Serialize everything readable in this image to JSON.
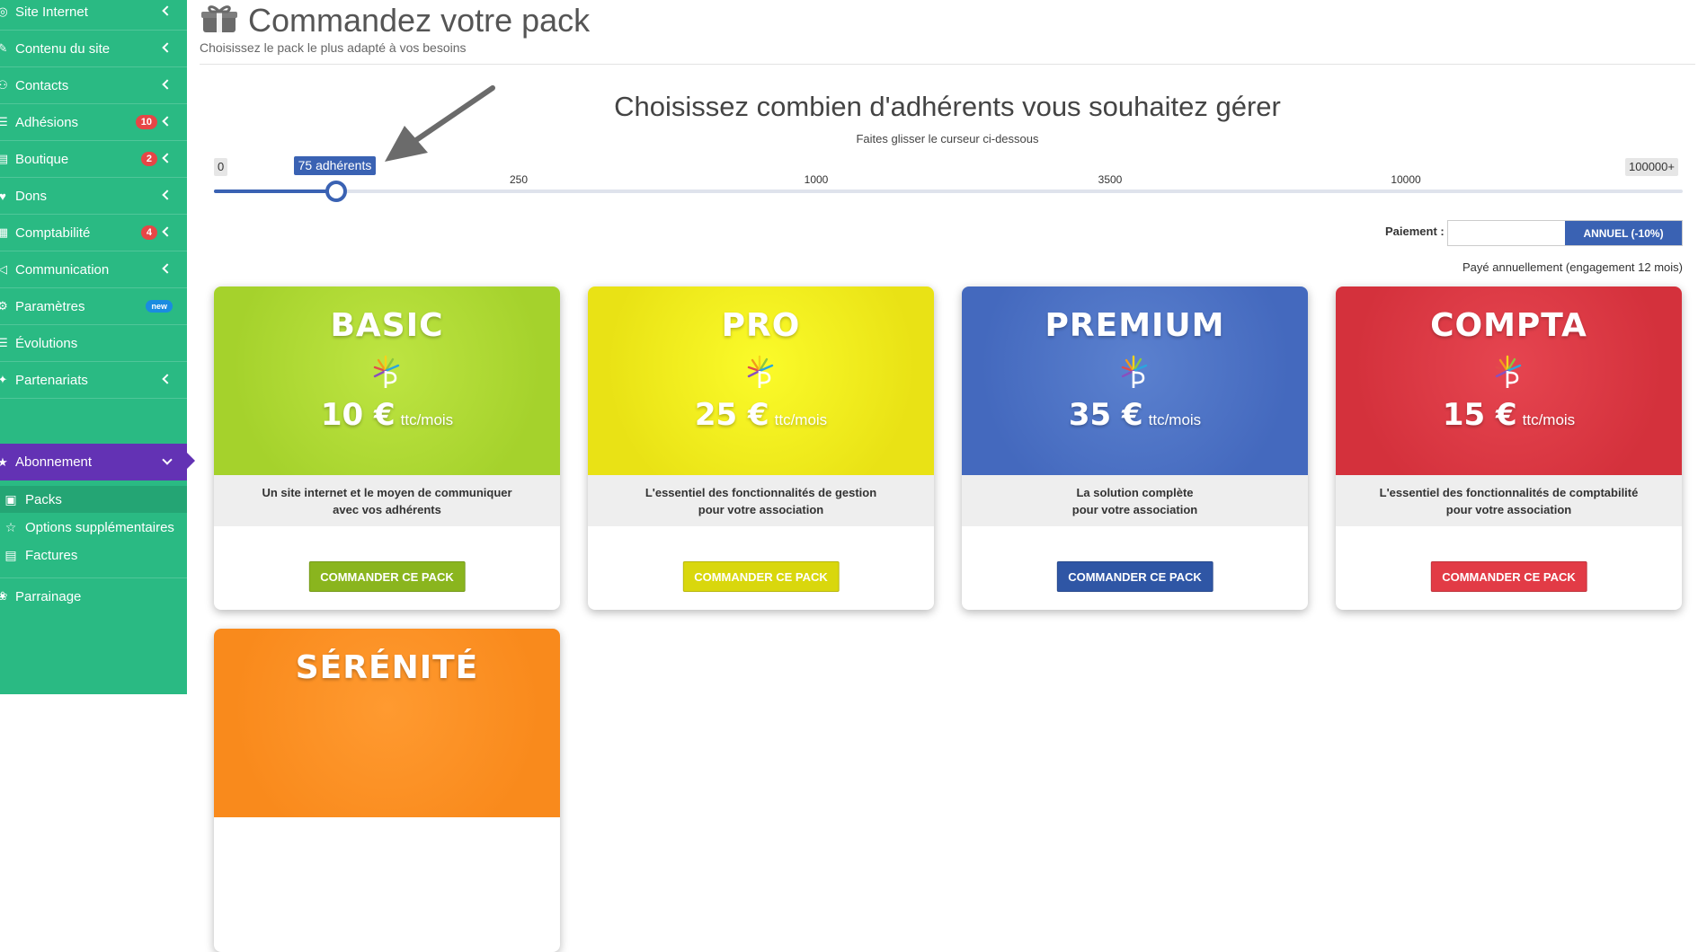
{
  "sidebar": {
    "items": [
      {
        "label": "Site Internet",
        "icon": "globe-icon",
        "badge": ""
      },
      {
        "label": "Contenu du site",
        "icon": "edit-icon",
        "badge": ""
      },
      {
        "label": "Contacts",
        "icon": "users-icon",
        "badge": ""
      },
      {
        "label": "Adhésions",
        "icon": "list-icon",
        "badge": "10"
      },
      {
        "label": "Boutique",
        "icon": "shop-icon",
        "badge": "2"
      },
      {
        "label": "Dons",
        "icon": "donate-icon",
        "badge": ""
      },
      {
        "label": "Comptabilité",
        "icon": "calculator-icon",
        "badge": "4"
      },
      {
        "label": "Communication",
        "icon": "megaphone-icon",
        "badge": ""
      },
      {
        "label": "Paramètres",
        "icon": "gear-icon",
        "badge": "new"
      },
      {
        "label": "Évolutions",
        "icon": "list-icon",
        "badge": ""
      },
      {
        "label": "Partenariats",
        "icon": "handshake-icon",
        "badge": ""
      }
    ],
    "active": {
      "label": "Abonnement",
      "icon": "star-icon"
    },
    "subitems": [
      {
        "label": "Packs",
        "icon": "box-icon"
      },
      {
        "label": "Options supplémentaires",
        "icon": "star-outline-icon"
      },
      {
        "label": "Factures",
        "icon": "invoice-icon"
      }
    ],
    "parrainage": {
      "label": "Parrainage",
      "icon": "gift-hand-icon"
    }
  },
  "header": {
    "title": "Commandez votre pack",
    "subtitle": "Choisissez le pack le plus adapté à vos besoins"
  },
  "slider": {
    "title": "Choisissez combien d'adhérents vous souhaitez gérer",
    "subtitle": "Faites glisser le curseur ci-dessous",
    "min_label": "0",
    "max_label": "100000+",
    "ticks": [
      "250",
      "1000",
      "3500",
      "10000"
    ],
    "value_label": "75 adhérents",
    "value_fraction": 0.083
  },
  "payment": {
    "label": "Paiement :",
    "option_monthly": "",
    "option_annual": "ANNUEL (-10%)",
    "note": "Payé annuellement (engagement 12 mois)"
  },
  "cards": [
    {
      "name": "BASIC",
      "price": "10 €",
      "period": "ttc/mois",
      "desc1": "Un site internet et le moyen de communiquer",
      "desc2": "avec vos adhérents",
      "button": "COMMANDER CE PACK",
      "color_light": "#bee542",
      "color_dark": "#a5d22c",
      "btn_color": "#8ab51e"
    },
    {
      "name": "PRO",
      "price": "25 €",
      "period": "ttc/mois",
      "desc1": "L'essentiel des fonctionnalités de gestion",
      "desc2": "pour votre association",
      "button": "COMMANDER CE PACK",
      "color_light": "#fbfb2a",
      "color_dark": "#e9e215",
      "btn_color": "#d9d70d"
    },
    {
      "name": "PREMIUM",
      "price": "35 €",
      "period": "ttc/mois",
      "desc1": "La solution complète",
      "desc2": "pour votre association",
      "button": "COMMANDER CE PACK",
      "color_light": "#5b81cf",
      "color_dark": "#4469be",
      "btn_color": "#2f56a5"
    },
    {
      "name": "COMPTA",
      "price": "15 €",
      "period": "ttc/mois",
      "desc1": "L'essentiel des fonctionnalités de comptabilité",
      "desc2": "pour votre association",
      "button": "COMMANDER CE PACK",
      "color_light": "#e64550",
      "color_dark": "#d4313c",
      "btn_color": "#e23b46"
    },
    {
      "name": "SÉRÉNITÉ",
      "color_light": "#ff9a30",
      "color_dark": "#f98a1c"
    }
  ]
}
